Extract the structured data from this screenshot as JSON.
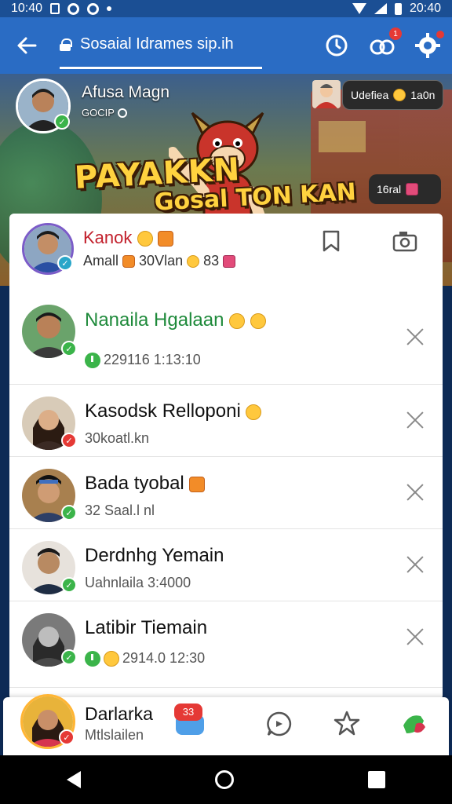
{
  "status_bar": {
    "time": "10:40",
    "time_right": "20:40"
  },
  "app_bar": {
    "search_text": "Sosaial Idrames sip.ih",
    "notification_badge": "1"
  },
  "banner": {
    "host_name": "Afusa Magn",
    "host_sub": "GOCIP",
    "status_pill": "Udefiea",
    "status_pill_extra": "1a0n",
    "logo_line1": "PAYAKKN",
    "logo_line2": "Gosal TON KAN",
    "viewers": "16ral"
  },
  "active_user": {
    "name": "Kanok",
    "sub": "Amall",
    "sub_time": "30Vlan",
    "sub_count": "83"
  },
  "rows": [
    {
      "name": "Nanaila Hgalaan",
      "sub": "229116 1:13:10"
    },
    {
      "name": "Kasodsk Relloponi",
      "sub": "30koatl.kn"
    },
    {
      "name": "Bada tyobal",
      "sub": "32 Saal.l nl"
    },
    {
      "name": "Derdnhg Yemain",
      "sub": "Uahnlaila 3:4000"
    },
    {
      "name": "Latibir Tiemain",
      "sub": "2914.0 12:30"
    }
  ],
  "bottom_user": {
    "name": "Darlarka",
    "sub": "Mtlslailen",
    "chat_badge": "33"
  },
  "colors": {
    "app_bar": "#2a6cc4",
    "status_bar": "#1b4f94",
    "online_badge": "#3bb44a",
    "alert_badge": "#e53935",
    "active_name": "#c21f2b",
    "highlight_name": "#1f8a3b"
  }
}
